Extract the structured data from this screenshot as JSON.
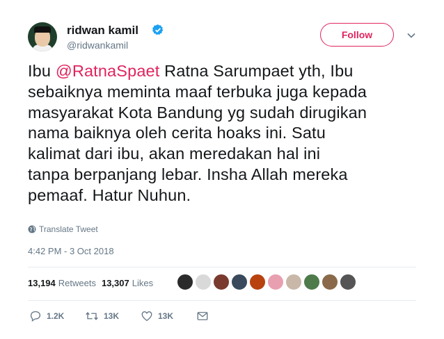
{
  "user": {
    "name": "ridwan kamil",
    "handle": "@ridwankamil"
  },
  "follow_label": "Follow",
  "tweet": {
    "lines": [
      {
        "pre": "Ibu ",
        "mention": "@RatnaSpaet",
        "post": " Ratna Sarumpaet yth, Ibu"
      },
      {
        "text": "sebaiknya meminta maaf terbuka juga kepada"
      },
      {
        "text": "masyarakat Kota Bandung yg sudah dirugikan"
      },
      {
        "text": "nama baiknya oleh cerita hoaks ini. Satu"
      },
      {
        "text": "kalimat dari ibu, akan meredakan hal ini"
      },
      {
        "text": "tanpa berpanjang lebar. Insha Allah mereka"
      },
      {
        "text": "pemaaf. Hatur Nuhun."
      }
    ]
  },
  "translate_label": "Translate Tweet",
  "timestamp": "4:42 PM - 3 Oct 2018",
  "stats": {
    "retweets_count": "13,194",
    "retweets_label": "Retweets",
    "likes_count": "13,307",
    "likes_label": "Likes"
  },
  "liked_by_avatars": [
    {
      "name": "user-1",
      "color": "#2b2b2b"
    },
    {
      "name": "user-2",
      "color": "#d9d9d9"
    },
    {
      "name": "user-3",
      "color": "#7a3b2e"
    },
    {
      "name": "user-4",
      "color": "#3a4a5c"
    },
    {
      "name": "user-5",
      "color": "#b8430f"
    },
    {
      "name": "user-6",
      "color": "#e8a0b0"
    },
    {
      "name": "user-7",
      "color": "#c9b8a8"
    },
    {
      "name": "user-8",
      "color": "#4f7a4a"
    },
    {
      "name": "user-9",
      "color": "#8a6a4a"
    },
    {
      "name": "user-10",
      "color": "#555555"
    }
  ],
  "actions": {
    "reply_count": "1.2K",
    "retweet_count": "13K",
    "like_count": "13K"
  },
  "colors": {
    "accent": "#e0245e",
    "verified": "#1da1f2",
    "muted": "#657786"
  }
}
